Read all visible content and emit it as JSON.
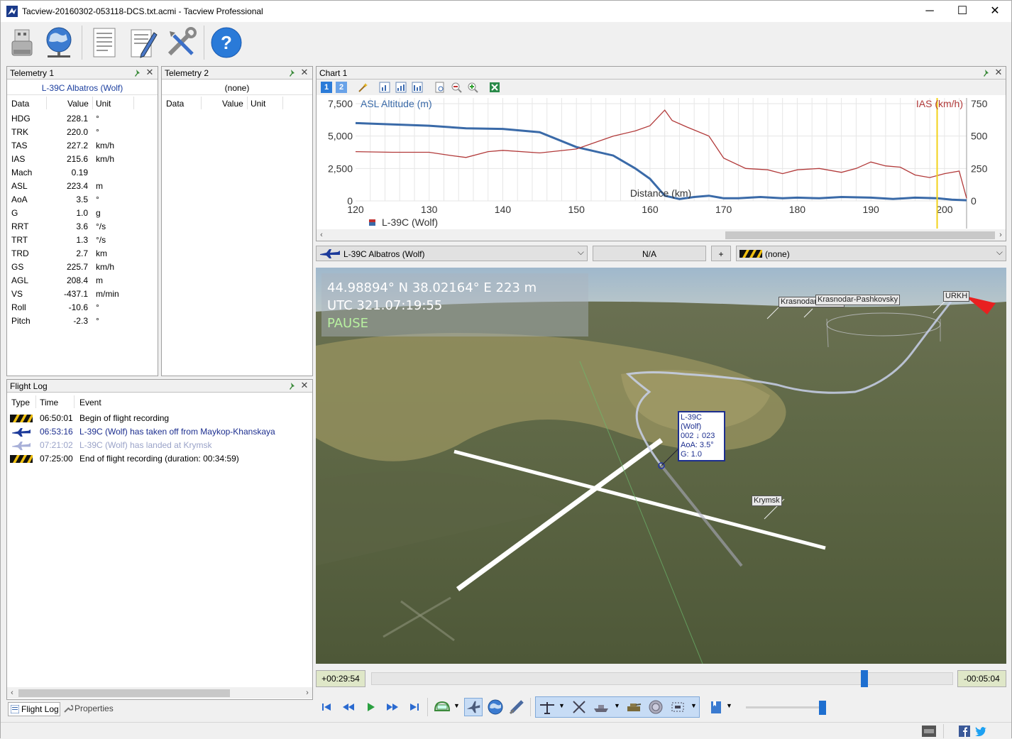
{
  "window": {
    "title": "Tacview-20160302-053118-DCS.txt.acmi - Tacview Professional",
    "minimize": "─",
    "maximize": "☐",
    "close": "✕"
  },
  "toolbar": {
    "items": [
      "usb-drive-icon",
      "globe-network-icon",
      "document-icon",
      "edit-document-icon",
      "tools-icon",
      "help-icon"
    ],
    "help_glyph": "?"
  },
  "telemetry1": {
    "title": "Telemetry 1",
    "object": "L-39C Albatros (Wolf)",
    "columns": [
      "Data",
      "Value",
      "Unit"
    ],
    "rows": [
      {
        "data": "HDG",
        "value": "228.1",
        "unit": "°"
      },
      {
        "data": "TRK",
        "value": "220.0",
        "unit": "°"
      },
      {
        "data": "TAS",
        "value": "227.2",
        "unit": "km/h"
      },
      {
        "data": "IAS",
        "value": "215.6",
        "unit": "km/h"
      },
      {
        "data": "Mach",
        "value": "0.19",
        "unit": ""
      },
      {
        "data": "ASL",
        "value": "223.4",
        "unit": "m"
      },
      {
        "data": "AoA",
        "value": "3.5",
        "unit": "°"
      },
      {
        "data": "G",
        "value": "1.0",
        "unit": "g"
      },
      {
        "data": "RRT",
        "value": "3.6",
        "unit": "°/s"
      },
      {
        "data": "TRT",
        "value": "1.3",
        "unit": "°/s"
      },
      {
        "data": "TRD",
        "value": "2.7",
        "unit": "km"
      },
      {
        "data": "GS",
        "value": "225.7",
        "unit": "km/h"
      },
      {
        "data": "AGL",
        "value": "208.4",
        "unit": "m"
      },
      {
        "data": "VS",
        "value": "-437.1",
        "unit": "m/min"
      },
      {
        "data": "Roll",
        "value": "-10.6",
        "unit": "°"
      },
      {
        "data": "Pitch",
        "value": "-2.3",
        "unit": "°"
      }
    ]
  },
  "telemetry2": {
    "title": "Telemetry 2",
    "object": "(none)",
    "columns": [
      "Data",
      "Value",
      "Unit"
    ]
  },
  "flightlog": {
    "title": "Flight Log",
    "columns": [
      "Type",
      "Time",
      "Event"
    ],
    "rows": [
      {
        "type": "hazard-stripe-icon",
        "time": "06:50:01",
        "event": "Begin of flight recording",
        "color": "#000000"
      },
      {
        "type": "aircraft-icon",
        "time": "06:53:16",
        "event": "L-39C (Wolf) has taken off from Maykop-Khanskaya",
        "color": "#1c2e8f"
      },
      {
        "type": "aircraft-faded-icon",
        "time": "07:21:02",
        "event": "L-39C (Wolf) has landed at Krymsk",
        "color": "#9aa3c8"
      },
      {
        "type": "hazard-stripe-icon",
        "time": "07:25:00",
        "event": "End of flight recording (duration: 00:34:59)",
        "color": "#000000"
      }
    ],
    "tabs": [
      "Flight Log",
      "Properties"
    ]
  },
  "chart_panel": {
    "title": "Chart 1",
    "toolbar_buttons": [
      "1",
      "2"
    ]
  },
  "chart_data": {
    "type": "line",
    "title": "",
    "xlabel": "Distance (km)",
    "x_ticks": [
      120,
      130,
      140,
      150,
      160,
      170,
      180,
      190,
      200
    ],
    "xlim": [
      120,
      203
    ],
    "left_axis": {
      "label": "ASL Altitude (m)",
      "ticks": [
        "7,500",
        "5,000",
        "2,500",
        "0"
      ],
      "ylim": [
        0,
        7500
      ],
      "color": "#3a6aa8"
    },
    "right_axis": {
      "label": "IAS (km/h)",
      "ticks": [
        "750",
        "500",
        "250",
        "0"
      ],
      "ylim": [
        0,
        750
      ],
      "color": "#b23a3a"
    },
    "cursor_x": 199,
    "legend": [
      "L-39C (Wolf)"
    ],
    "series": [
      {
        "name": "ASL Altitude (m)",
        "axis": "left",
        "x": [
          120,
          125,
          130,
          135,
          140,
          145,
          150,
          155,
          158,
          160,
          162,
          164,
          166,
          168,
          170,
          172,
          175,
          178,
          180,
          183,
          186,
          190,
          193,
          196,
          199,
          201,
          203
        ],
        "y": [
          6000,
          5900,
          5800,
          5600,
          5550,
          5300,
          4150,
          3500,
          2500,
          1700,
          400,
          150,
          300,
          400,
          200,
          200,
          300,
          200,
          250,
          200,
          300,
          250,
          150,
          250,
          200,
          100,
          50
        ]
      },
      {
        "name": "IAS (km/h)",
        "axis": "right",
        "x": [
          120,
          125,
          130,
          133,
          135,
          138,
          140,
          145,
          150,
          155,
          158,
          160,
          162,
          163,
          165,
          168,
          170,
          173,
          176,
          178,
          180,
          183,
          186,
          188,
          190,
          192,
          194,
          196,
          198,
          200,
          202,
          203
        ],
        "y": [
          380,
          375,
          375,
          350,
          335,
          380,
          390,
          370,
          400,
          500,
          540,
          580,
          700,
          620,
          570,
          500,
          330,
          250,
          240,
          210,
          240,
          250,
          220,
          250,
          300,
          270,
          260,
          200,
          180,
          210,
          230,
          20
        ]
      }
    ]
  },
  "selectors": {
    "primary": "L-39C Albatros (Wolf)",
    "middle": "N/A",
    "plus": "+",
    "secondary": "(none)"
  },
  "view3d": {
    "hud": {
      "coords": "44.98894° N  38.02164° E  223 m",
      "utc": "UTC 321.07:19:55",
      "status": "PAUSE"
    },
    "labels": [
      "Krasnodar-Center",
      "Krasnodar-Pashkovsky",
      "URKH",
      "Krymsk"
    ],
    "aircraft_label": [
      "L-39C (Wolf)",
      "002 ↓ 023",
      "AoA: 3.5°",
      "G: 1.0"
    ]
  },
  "timeline": {
    "elapsed": "+00:29:54",
    "remaining": "-00:05:04",
    "position_fraction": 0.844
  },
  "controls": {
    "playback": [
      "skip-to-start-icon",
      "rewind-icon",
      "play-icon",
      "fast-forward-icon",
      "skip-to-end-icon"
    ],
    "volume_fraction": 0.8
  }
}
